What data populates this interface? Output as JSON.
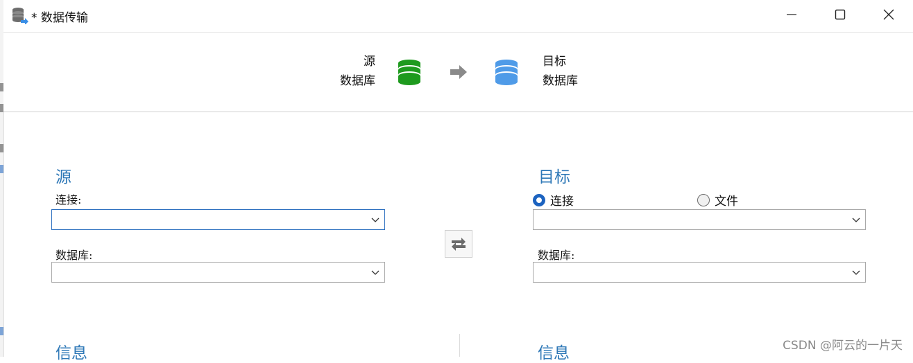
{
  "window": {
    "title": "* 数据传输",
    "controls": {
      "minimize": "minimize-icon",
      "maximize": "maximize-icon",
      "close": "close-icon"
    }
  },
  "header": {
    "source_label_line1": "源",
    "source_label_line2": "数据库",
    "target_label_line1": "目标",
    "target_label_line2": "数据库",
    "source_db_color": "#1e9a1e",
    "target_db_color": "#4f9be8",
    "arrow_color": "#8a8a8a"
  },
  "source": {
    "title": "源",
    "connection_label": "连接:",
    "connection_value": "",
    "database_label": "数据库:",
    "database_value": "",
    "info_title": "信息"
  },
  "target": {
    "title": "目标",
    "mode_connection_label": "连接",
    "mode_file_label": "文件",
    "selected_mode": "connection",
    "connection_value": "",
    "database_label": "数据库:",
    "database_value": "",
    "info_title": "信息"
  },
  "swap": {
    "icon": "swap-arrows-icon"
  },
  "watermark": "CSDN @阿云的一片天",
  "colors": {
    "accent": "#2e78b7",
    "radio": "#1c63c0",
    "focus": "#2c6fbf"
  }
}
